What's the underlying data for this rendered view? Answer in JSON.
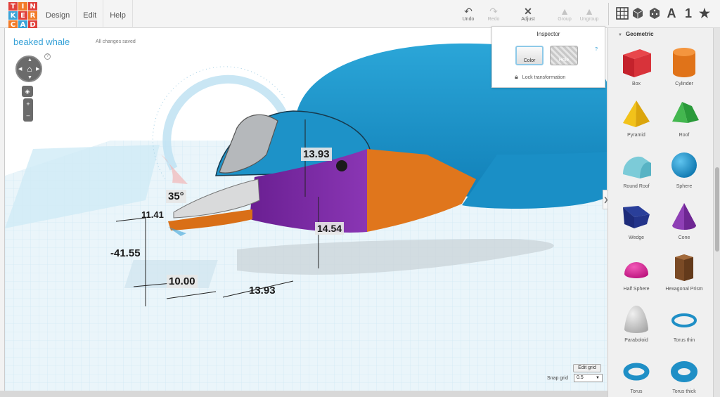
{
  "logo": {
    "letters": [
      "T",
      "I",
      "N",
      "K",
      "E",
      "R",
      "C",
      "A",
      "D"
    ],
    "colors": [
      "#e0403b",
      "#f27b28",
      "#f2c530",
      "#3aa3d8",
      "#e0403b",
      "#6b6b6b",
      "#f27b28",
      "#3aa3d8",
      "#6b6b6b"
    ]
  },
  "menu": {
    "items": [
      "Design",
      "Edit",
      "Help"
    ]
  },
  "toolbar": {
    "undo_label": "Undo",
    "redo_label": "Redo",
    "adjust_label": "Adjust",
    "group_label": "Group",
    "ungroup_label": "Ungroup",
    "view_text": "A",
    "view_number": "1"
  },
  "design": {
    "title": "beaked whale",
    "status": "All changes saved",
    "help": "?"
  },
  "measurements": {
    "height_top": "13.93",
    "height_bottom": "14.54",
    "angle": "35°",
    "x_offset": "11.41",
    "y_offset": "-41.55",
    "width": "10.00",
    "length": "13.93"
  },
  "inspector": {
    "title": "Inspector",
    "color_label": "Color",
    "hole_label": "Hole",
    "help": "?",
    "lock_label": "Lock transformation"
  },
  "grid": {
    "edit_label": "Edit grid",
    "snap_label": "Snap grid",
    "snap_value": "0.5"
  },
  "shapes_panel": {
    "category": "Geometric",
    "items": [
      {
        "label": "Box",
        "icon": "box-icon"
      },
      {
        "label": "Cylinder",
        "icon": "cylinder-icon"
      },
      {
        "label": "Pyramid",
        "icon": "pyramid-icon"
      },
      {
        "label": "Roof",
        "icon": "roof-icon"
      },
      {
        "label": "Round Roof",
        "icon": "round-roof-icon"
      },
      {
        "label": "Sphere",
        "icon": "sphere-icon"
      },
      {
        "label": "Wedge",
        "icon": "wedge-icon"
      },
      {
        "label": "Cone",
        "icon": "cone-icon"
      },
      {
        "label": "Half Sphere",
        "icon": "half-sphere-icon"
      },
      {
        "label": "Hexagonal Prism",
        "icon": "hexagonal-prism-icon"
      },
      {
        "label": "Paraboloid",
        "icon": "paraboloid-icon"
      },
      {
        "label": "Torus thin",
        "icon": "torus-thin-icon"
      },
      {
        "label": "Torus",
        "icon": "torus-icon"
      },
      {
        "label": "Torus thick",
        "icon": "torus-thick-icon"
      }
    ]
  },
  "colors": {
    "accent": "#3aa3d8",
    "whale_blue": "#1f95c9",
    "purple": "#7a2aa0",
    "orange": "#e0761c",
    "grey": "#b9b9b9"
  }
}
